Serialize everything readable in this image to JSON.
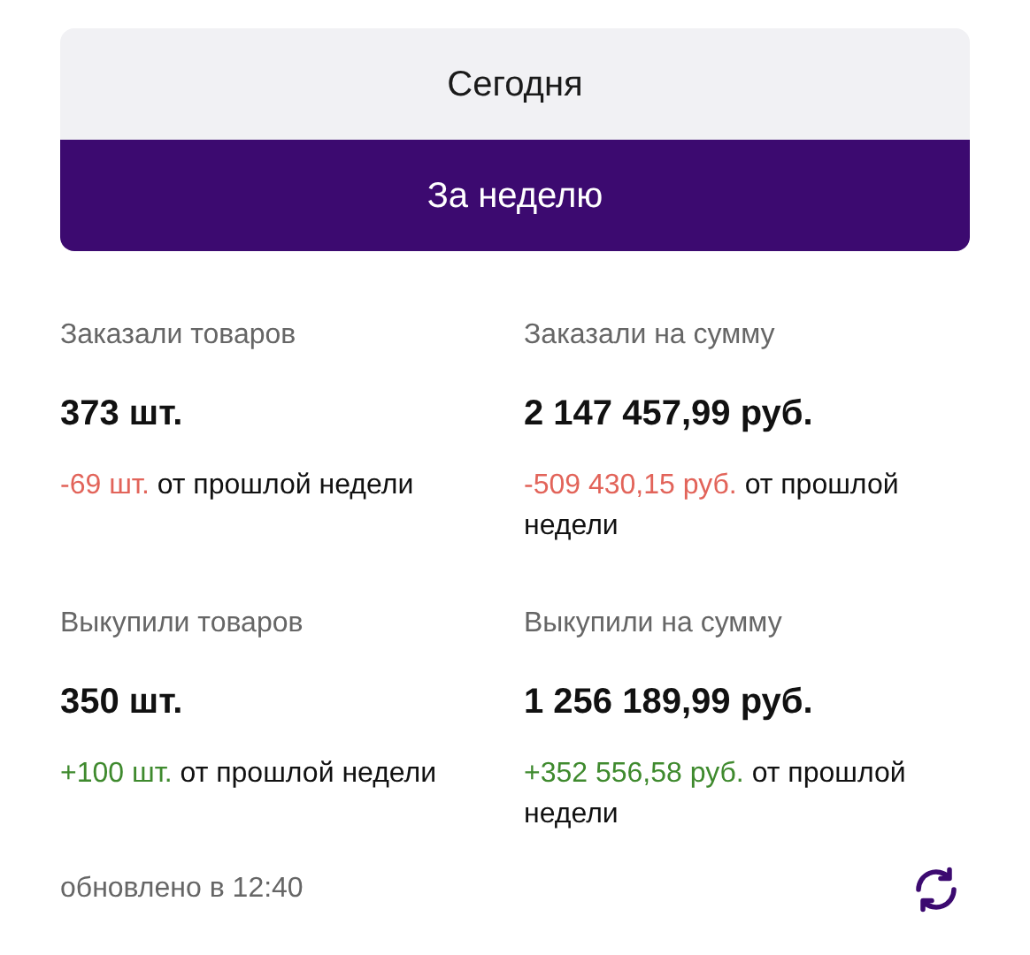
{
  "tabs": [
    {
      "label": "Сегодня",
      "selected": false
    },
    {
      "label": "За неделю",
      "selected": true
    }
  ],
  "stats": [
    {
      "label": "Заказали товаров",
      "value": "373 шт.",
      "delta": "-69 шт.",
      "delta_note": "от прошлой недели",
      "color": "#e2645a"
    },
    {
      "label": "Заказали на сумму",
      "value": "2 147 457,99 руб.",
      "delta": "-509 430,15 руб.",
      "delta_note": "от прошлой недели",
      "color": "#e2645a"
    },
    {
      "label": "Выкупили товаров",
      "value": "350 шт.",
      "delta": "+100 шт.",
      "delta_note": "от прошлой недели",
      "color": "#3f8a2e"
    },
    {
      "label": "Выкупили на сумму",
      "value": "1 256 189,99 руб.",
      "delta": "+352 556,58 руб.",
      "delta_note": "от прошлой недели",
      "color": "#3f8a2e"
    }
  ],
  "updated": "обновлено в 12:40"
}
